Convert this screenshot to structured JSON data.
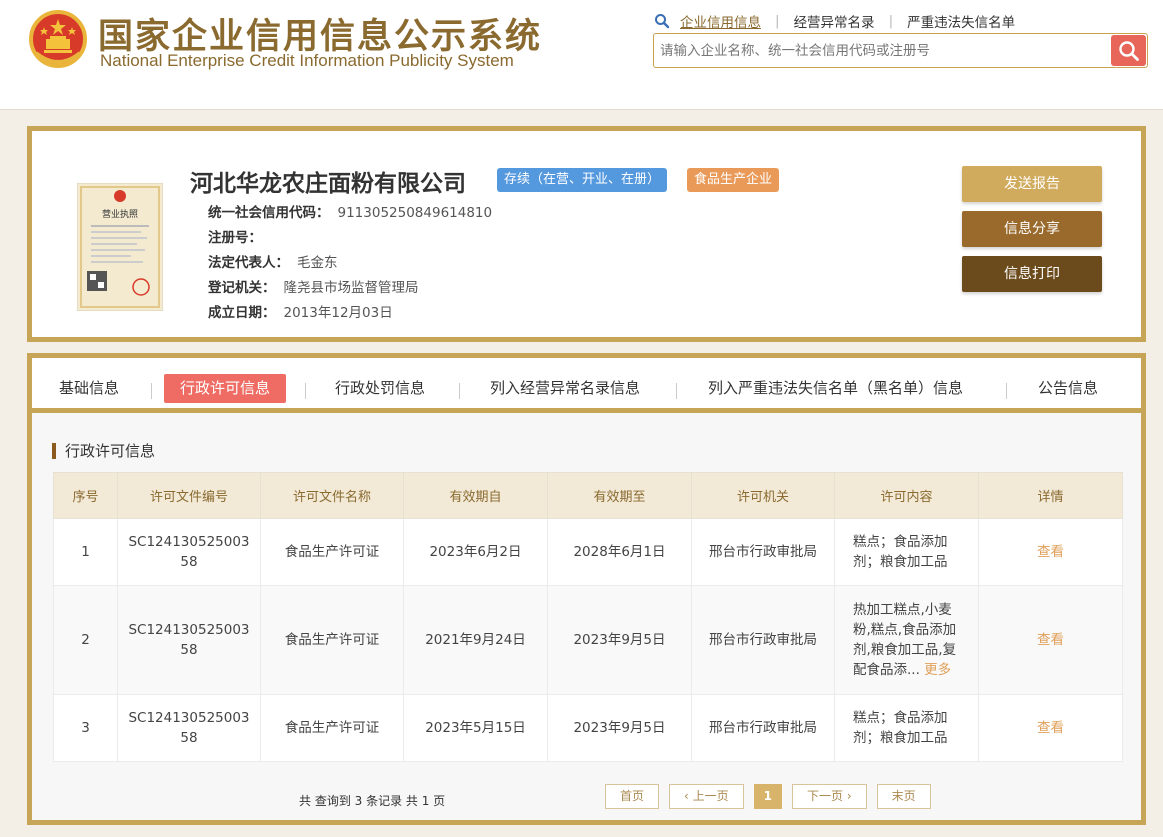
{
  "header": {
    "title_cn": "国家企业信用信息公示系统",
    "title_en": "National Enterprise Credit Information Publicity System",
    "nav": [
      "企业信用信息",
      "经营异常名录",
      "严重违法失信名单"
    ],
    "search_placeholder": "请输入企业名称、统一社会信用代码或注册号"
  },
  "company": {
    "name": "河北华龙农庄面粉有限公司",
    "status_badge": "存续（在营、开业、在册）",
    "type_badge": "食品生产企业",
    "license_caption": "营业执照",
    "fields": [
      {
        "label": "统一社会信用代码：",
        "value": "911305250849614810"
      },
      {
        "label": "注册号：",
        "value": ""
      },
      {
        "label": "法定代表人：",
        "value": "毛金东"
      },
      {
        "label": "登记机关：",
        "value": "隆尧县市场监督管理局"
      },
      {
        "label": "成立日期：",
        "value": "2013年12月03日"
      }
    ],
    "actions": [
      "发送报告",
      "信息分享",
      "信息打印"
    ]
  },
  "tabs": [
    "基础信息",
    "行政许可信息",
    "行政处罚信息",
    "列入经营异常名录信息",
    "列入严重违法失信名单（黑名单）信息",
    "公告信息"
  ],
  "section_title": "行政许可信息",
  "table": {
    "headers": [
      "序号",
      "许可文件编号",
      "许可文件名称",
      "有效期自",
      "有效期至",
      "许可机关",
      "许可内容",
      "详情"
    ],
    "rows": [
      {
        "no": "1",
        "code": "SC12413052500358",
        "name": "食品生产许可证",
        "from": "2023年6月2日",
        "to": "2028年6月1日",
        "authority": "邢台市行政审批局",
        "content": "糕点；食品添加剂；粮食加工品",
        "more": "",
        "detail": "查看"
      },
      {
        "no": "2",
        "code": "SC12413052500358",
        "name": "食品生产许可证",
        "from": "2021年9月24日",
        "to": "2023年9月5日",
        "authority": "邢台市行政审批局",
        "content": "热加工糕点,小麦粉,糕点,食品添加剂,粮食加工品,复配食品添...",
        "more": "更多",
        "detail": "查看"
      },
      {
        "no": "3",
        "code": "SC12413052500358",
        "name": "食品生产许可证",
        "from": "2023年5月15日",
        "to": "2023年9月5日",
        "authority": "邢台市行政审批局",
        "content": "糕点；食品添加剂；粮食加工品",
        "more": "",
        "detail": "查看"
      }
    ]
  },
  "pagination": {
    "summary": "共 查询到 3 条记录 共 1 页",
    "first": "首页",
    "prev": "上一页",
    "current": "1",
    "next": "下一页",
    "last": "末页"
  },
  "colors": {
    "gold": "#c6a557",
    "brown": "#8a6a2f",
    "active_tab": "#ee6c64",
    "status_badge": "#5498de",
    "type_badge": "#e99a58"
  }
}
